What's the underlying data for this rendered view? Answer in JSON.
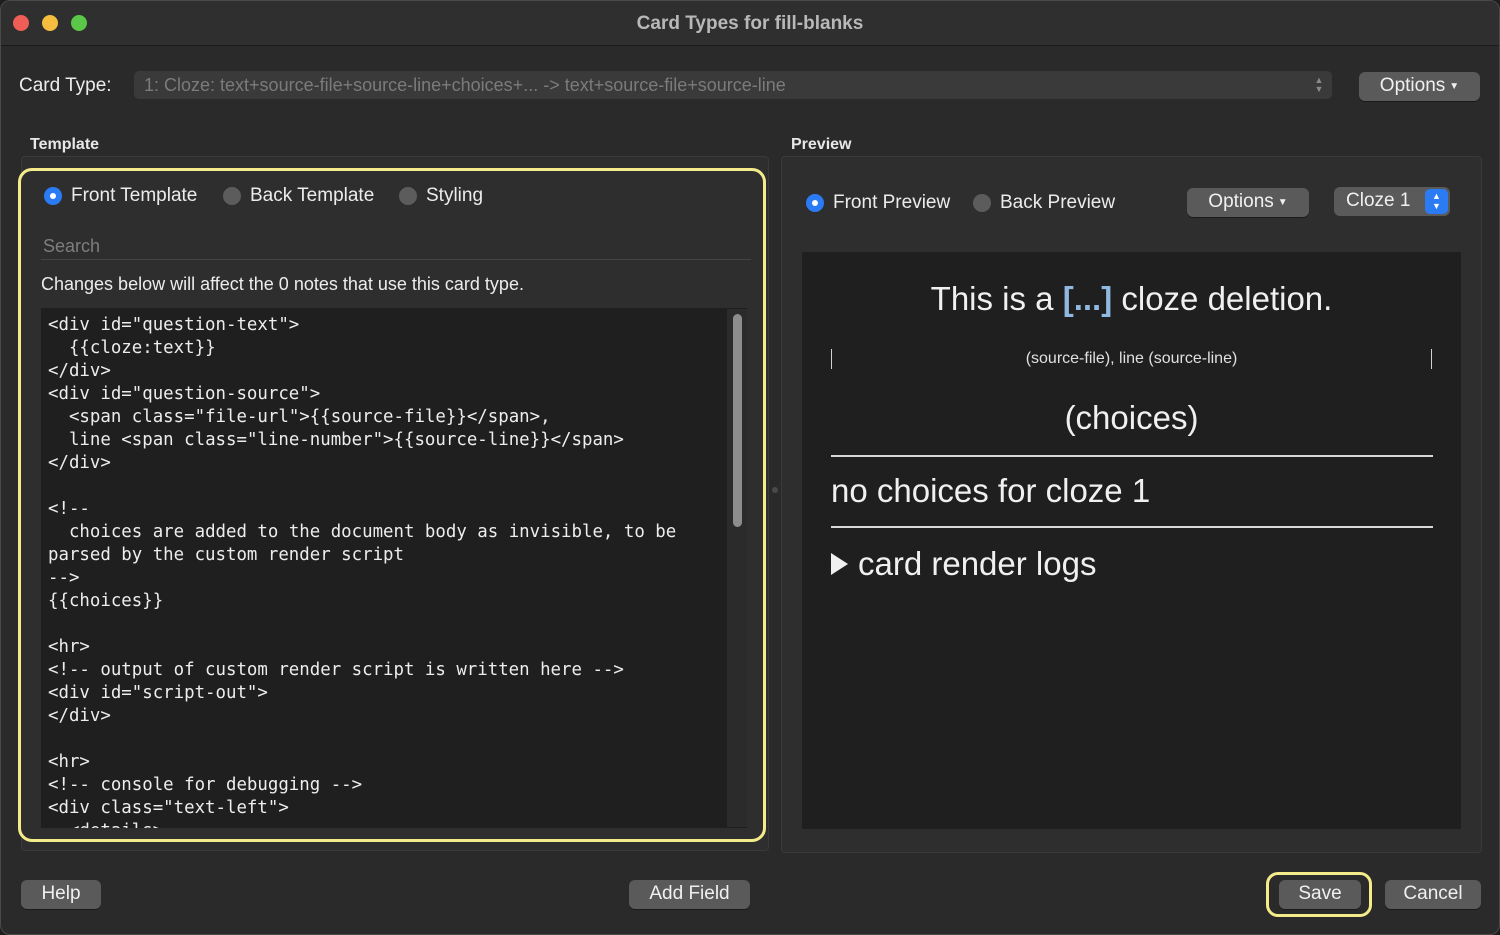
{
  "window": {
    "title": "Card Types for fill-blanks"
  },
  "card_type": {
    "label": "Card Type:",
    "value": "1: Cloze: text+source-file+source-line+choices+... -> text+source-file+source-line",
    "options_label": "Options"
  },
  "template": {
    "section_label": "Template",
    "radios": {
      "front": "Front Template",
      "back": "Back Template",
      "styling": "Styling",
      "selected": "front"
    },
    "search_placeholder": "Search",
    "notice": "Changes below will affect the 0 notes that use this card type.",
    "code": "<div id=\"question-text\">\n  {{cloze:text}}\n</div>\n<div id=\"question-source\">\n  <span class=\"file-url\">{{source-file}}</span>,\n  line <span class=\"line-number\">{{source-line}}</span>\n</div>\n\n<!--\n  choices are added to the document body as invisible, to be parsed by the custom render script\n-->\n{{choices}}\n\n<hr>\n<!-- output of custom render script is written here -->\n<div id=\"script-out\">\n</div>\n\n<hr>\n<!-- console for debugging -->\n<div class=\"text-left\">\n  <details>"
  },
  "preview": {
    "section_label": "Preview",
    "radios": {
      "front": "Front Preview",
      "back": "Back Preview",
      "selected": "front"
    },
    "options_label": "Options",
    "cloze_select": "Cloze 1",
    "content": {
      "cloze_before": "This is a",
      "cloze_mark": "[...]",
      "cloze_after": "cloze deletion.",
      "source": "(source-file), line (source-line)",
      "choices": "(choices)",
      "no_choices": "no choices for cloze 1",
      "logs": "card render logs"
    }
  },
  "footer": {
    "help": "Help",
    "add_field": "Add Field",
    "save": "Save",
    "cancel": "Cancel"
  }
}
